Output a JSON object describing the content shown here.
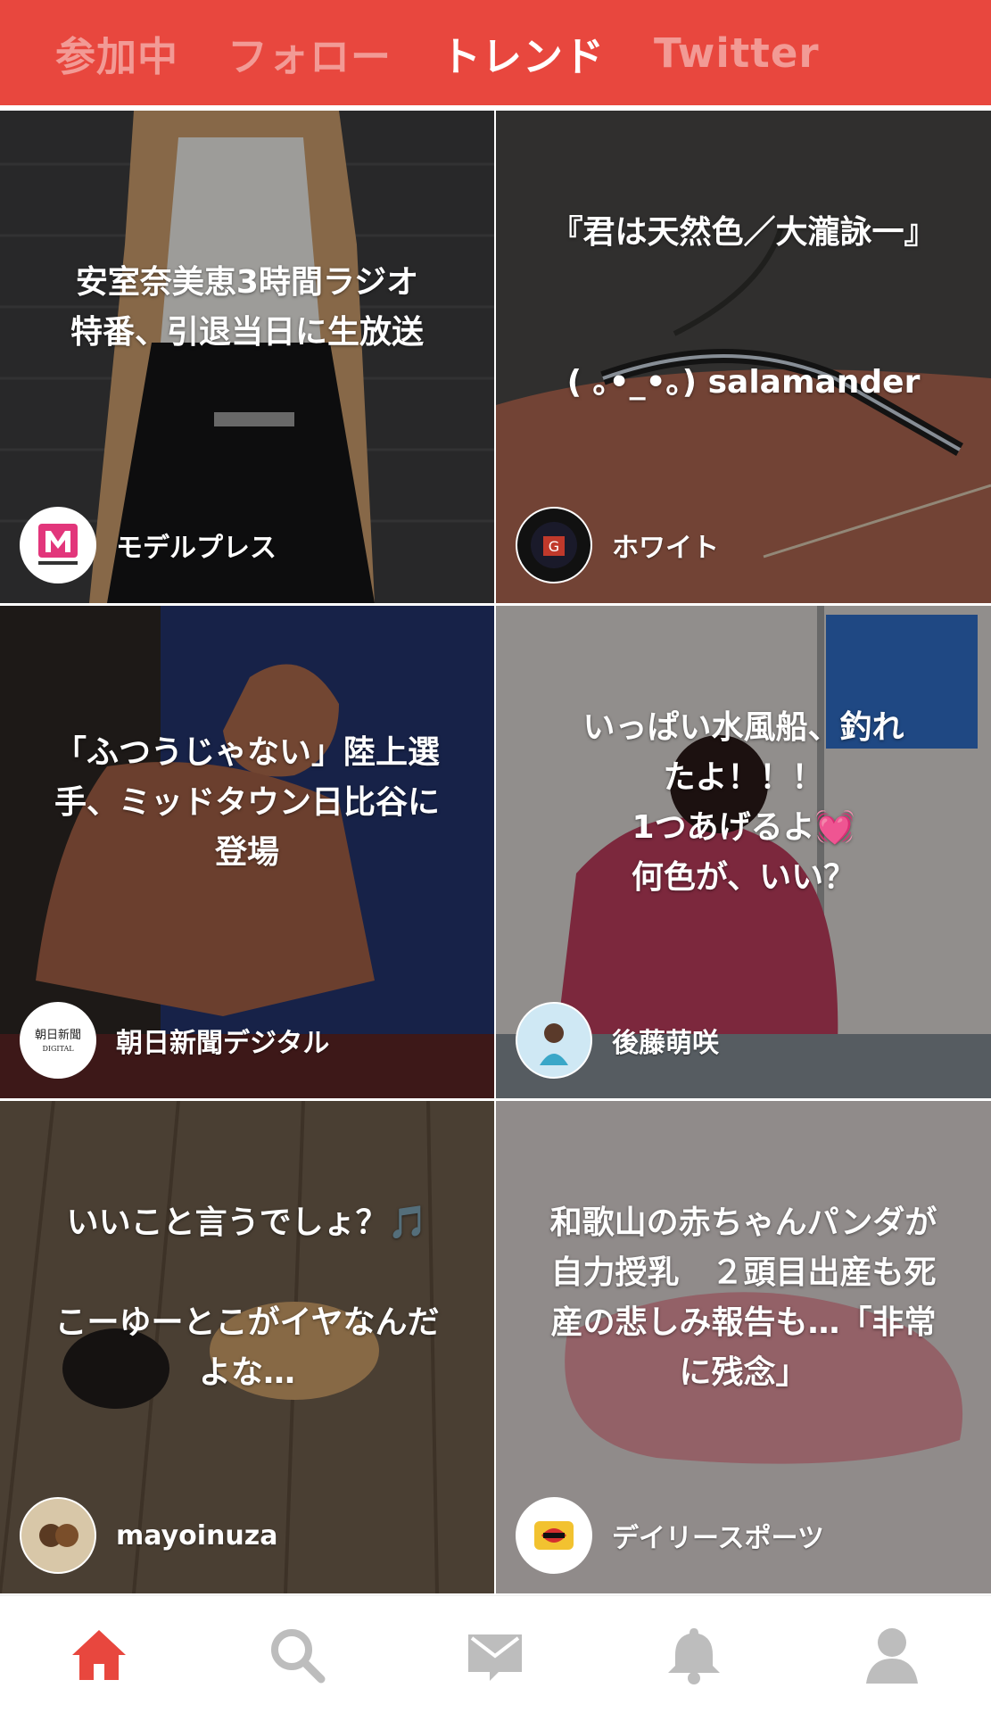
{
  "header": {
    "tabs": [
      {
        "label": "参加中",
        "active": false
      },
      {
        "label": "フォロー",
        "active": false
      },
      {
        "label": "トレンド",
        "active": true
      },
      {
        "label": "Twitter",
        "active": false
      }
    ],
    "accent_color": "#e8473e"
  },
  "cards": [
    {
      "title": "安室奈美恵3時間ラジオ\n特番、引退当日に生放送",
      "source": "モデルプレス",
      "avatar_icon": "modelpress-logo-icon"
    },
    {
      "title": "『君は天然色／大瀧詠一』\n\n\n( ｡•_•｡) salamander",
      "source": "ホワイト",
      "avatar_icon": "white-user-avatar-icon"
    },
    {
      "title": "「ふつうじゃない」陸上選\n手、ミッドタウン日比谷に\n登場",
      "source": "朝日新聞デジタル",
      "avatar_icon": "asahi-digital-logo-icon"
    },
    {
      "title": "いっぱい水風船、釣れ\nたよ！！！\n1つあげるよ💓\n何色が、いい？",
      "source": "後藤萌咲",
      "avatar_icon": "user-avatar-icon"
    },
    {
      "title": "いいこと言うでしょ？🎵\n\nこーゆーとこがイヤなんだ\nよな…",
      "source": "mayoinuza",
      "avatar_icon": "user-avatar-icon"
    },
    {
      "title": "和歌山の赤ちゃんパンダが\n自力授乳　２頭目出産も死\n産の悲しみ報告も…「非常\nに残念」",
      "source": "デイリースポーツ",
      "avatar_icon": "daily-sports-logo-icon"
    }
  ],
  "bottom_nav": [
    {
      "icon": "home-icon",
      "active": true
    },
    {
      "icon": "search-icon",
      "active": false
    },
    {
      "icon": "mail-icon",
      "active": false
    },
    {
      "icon": "bell-icon",
      "active": false
    },
    {
      "icon": "profile-icon",
      "active": false
    }
  ]
}
